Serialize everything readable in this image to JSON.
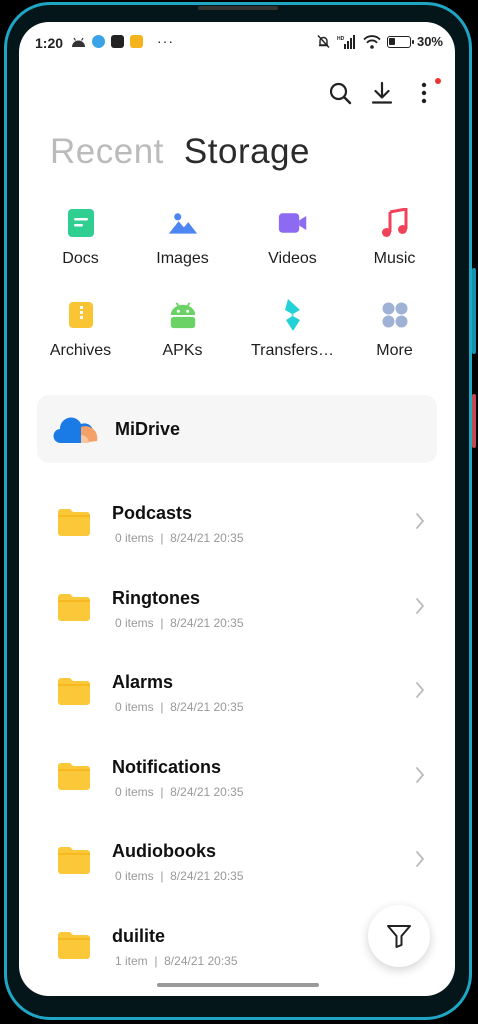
{
  "status_bar": {
    "time": "1:20",
    "more_indicator": "···",
    "battery_text": "30%",
    "battery_level": 0.3
  },
  "toolbar": {
    "icons": [
      "search-icon",
      "download-icon",
      "more-vert-icon"
    ]
  },
  "tabs": [
    {
      "label": "Recent",
      "active": false
    },
    {
      "label": "Storage",
      "active": true
    }
  ],
  "categories": [
    {
      "label": "Docs",
      "icon": "docs-icon",
      "color": "#2fcf92"
    },
    {
      "label": "Images",
      "icon": "images-icon",
      "color": "#4e86f1"
    },
    {
      "label": "Videos",
      "icon": "videos-icon",
      "color": "#8d6af2"
    },
    {
      "label": "Music",
      "icon": "music-icon",
      "color": "#f0435b"
    },
    {
      "label": "Archives",
      "icon": "archives-icon",
      "color": "#f9c534"
    },
    {
      "label": "APKs",
      "icon": "apks-icon",
      "color": "#6bd366"
    },
    {
      "label": "Transfers…",
      "icon": "transfers-icon",
      "color": "#23d2d6"
    },
    {
      "label": "More",
      "icon": "more-grid-icon",
      "color": "#9fb1d5"
    }
  ],
  "midrive": {
    "label": "MiDrive"
  },
  "folders": [
    {
      "name": "Podcasts",
      "meta": "0 items  |  8/24/21 20:35"
    },
    {
      "name": "Ringtones",
      "meta": "0 items  |  8/24/21 20:35"
    },
    {
      "name": "Alarms",
      "meta": "0 items  |  8/24/21 20:35"
    },
    {
      "name": "Notifications",
      "meta": "0 items  |  8/24/21 20:35"
    },
    {
      "name": "Audiobooks",
      "meta": "0 items  |  8/24/21 20:35"
    },
    {
      "name": "duilite",
      "meta": "1 item  |  8/24/21 20:35"
    }
  ],
  "colors": {
    "folder": "#fbc83a",
    "accent_frame": "#1fa6c4"
  }
}
